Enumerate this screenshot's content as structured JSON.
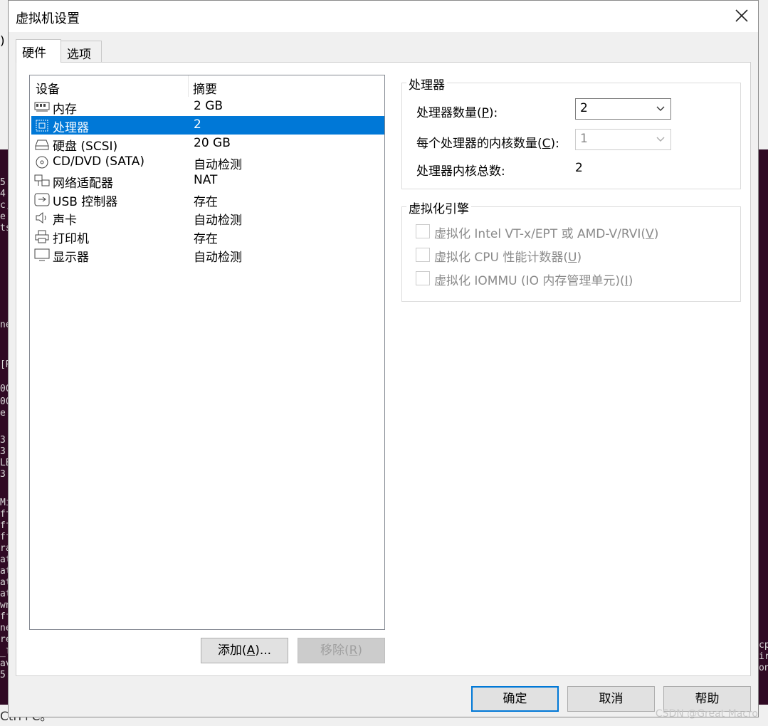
{
  "window": {
    "title": "虚拟机设置"
  },
  "tabs": [
    {
      "label": "硬件"
    },
    {
      "label": "选项"
    }
  ],
  "device_list": {
    "columns": [
      "设备",
      "摘要"
    ],
    "rows": [
      {
        "name": "内存",
        "summary": "2 GB",
        "icon": "memory-icon"
      },
      {
        "name": "处理器",
        "summary": "2",
        "icon": "processor-icon",
        "selected": true
      },
      {
        "name": "硬盘 (SCSI)",
        "summary": "20 GB",
        "icon": "hard-disk-icon"
      },
      {
        "name": "CD/DVD (SATA)",
        "summary": "自动检测",
        "icon": "cd-dvd-icon"
      },
      {
        "name": "网络适配器",
        "summary": "NAT",
        "icon": "network-adapter-icon"
      },
      {
        "name": "USB 控制器",
        "summary": "存在",
        "icon": "usb-icon"
      },
      {
        "name": "声卡",
        "summary": "自动检测",
        "icon": "sound-card-icon"
      },
      {
        "name": "打印机",
        "summary": "存在",
        "icon": "printer-icon"
      },
      {
        "name": "显示器",
        "summary": "自动检测",
        "icon": "display-icon"
      }
    ]
  },
  "buttons": {
    "add": {
      "pre": "添加(",
      "key": "A",
      "post": ")..."
    },
    "remove": {
      "pre": "移除(",
      "key": "R",
      "post": ")"
    },
    "ok": "确定",
    "cancel": "取消",
    "help": "帮助"
  },
  "processor_group": {
    "legend": "处理器",
    "count_label": {
      "pre": "处理器数量(",
      "key": "P",
      "post": "):"
    },
    "count_value": "2",
    "cores_label": {
      "pre": "每个处理器的内核数量(",
      "key": "C",
      "post": "):"
    },
    "cores_value": "1",
    "total_label": "处理器内核总数:",
    "total_value": "2"
  },
  "virtualization_group": {
    "legend": "虚拟化引擎",
    "options": [
      {
        "pre": "虚拟化 Intel VT-x/EPT 或 AMD-V/RVI(",
        "key": "V",
        "post": ")",
        "checked": false,
        "enabled": false
      },
      {
        "pre": "虚拟化 CPU 性能计数器(",
        "key": "U",
        "post": ")",
        "checked": false,
        "enabled": false
      },
      {
        "pre": "虚拟化 IOMMU (IO 内存管理单元)(",
        "key": "I",
        "post": ")",
        "checked": false,
        "enabled": false
      }
    ]
  },
  "background_terminal": {
    "left_chars": [
      "5.",
      "4",
      "c,",
      "e",
      "ts",
      "ne",
      "[R",
      "00",
      "00",
      "e",
      "3",
      "3",
      "LB",
      "3",
      "Mi",
      "ff",
      "ff",
      "ff",
      "ra",
      "at",
      "at",
      "at",
      "at",
      "wn",
      "ff",
      "ne",
      "re",
      "_l",
      "av",
      "5."
    ],
    "right_chars": [
      "cp",
      "ir",
      "on"
    ],
    "bottom_text": "Ctrl+C。"
  },
  "watermark": "CSDN @Great Macro",
  "colors": {
    "selection": "#0078d7",
    "dialog_bg": "#f0f0f0",
    "terminal_bg": "#300a24"
  }
}
